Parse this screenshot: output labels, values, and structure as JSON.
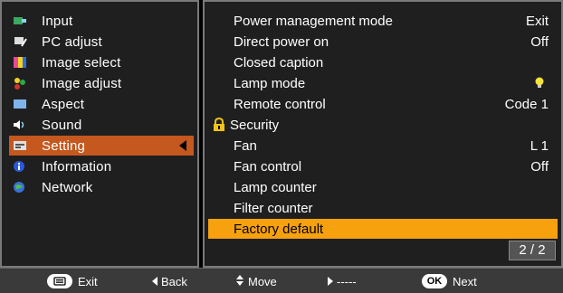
{
  "left_menu": {
    "items": [
      {
        "label": "Input",
        "icon": "input-icon"
      },
      {
        "label": "PC adjust",
        "icon": "pc-adjust-icon"
      },
      {
        "label": "Image select",
        "icon": "image-select-icon"
      },
      {
        "label": "Image adjust",
        "icon": "image-adjust-icon"
      },
      {
        "label": "Aspect",
        "icon": "aspect-icon"
      },
      {
        "label": "Sound",
        "icon": "speaker-icon"
      },
      {
        "label": "Setting",
        "icon": "setting-icon",
        "selected": true
      },
      {
        "label": "Information",
        "icon": "info-icon"
      },
      {
        "label": "Network",
        "icon": "network-icon"
      }
    ]
  },
  "right_menu": {
    "items": [
      {
        "label": "Power management mode",
        "value": "Exit"
      },
      {
        "label": "Direct power on",
        "value": "Off"
      },
      {
        "label": "Closed caption",
        "value": ""
      },
      {
        "label": "Lamp mode",
        "value": ""
      },
      {
        "label": "Remote control",
        "value": "Code 1"
      },
      {
        "label": "Security",
        "value": ""
      },
      {
        "label": "Fan",
        "value": "L 1"
      },
      {
        "label": "Fan control",
        "value": "Off"
      },
      {
        "label": "Lamp counter",
        "value": ""
      },
      {
        "label": "Filter counter",
        "value": ""
      },
      {
        "label": "Factory default",
        "value": "",
        "selected": true
      }
    ],
    "page_indicator": "2 / 2"
  },
  "bottom_bar": {
    "exit_label": "Exit",
    "back_label": "Back",
    "move_label": "Move",
    "next_dash_label": "-----",
    "ok_pill": "OK",
    "next_label": "Next"
  },
  "colors": {
    "left_selected": "#c4581f",
    "right_selected": "#f7a10f",
    "panel_bg": "#1f1f1f"
  }
}
